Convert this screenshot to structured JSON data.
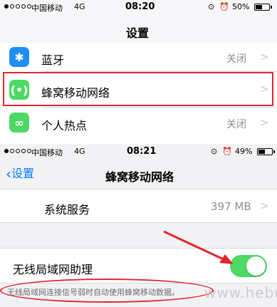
{
  "screen1": {
    "status": {
      "carrier": "中国移动",
      "network": "4G",
      "time": "08:20",
      "battery": "50%",
      "battery_level": 0.5
    },
    "title": "设置",
    "rows": [
      {
        "label": "蓝牙",
        "value": "关闭",
        "icon": "bluetooth-icon",
        "color": "#1f8ef1"
      },
      {
        "label": "蜂窝移动网络",
        "value": "",
        "icon": "cellular-icon",
        "color": "#4cd964"
      },
      {
        "label": "个人热点",
        "value": "关闭",
        "icon": "hotspot-icon",
        "color": "#4cd964"
      }
    ]
  },
  "screen2": {
    "status": {
      "carrier": "中国移动",
      "network": "4G",
      "time": "08:21",
      "battery": "49%",
      "battery_level": 0.49
    },
    "back_label": "设置",
    "title": "蜂窝移动网络",
    "system_services": {
      "label": "系统服务",
      "value": "397 MB"
    },
    "wifi_assist": {
      "label": "无线局域网助理",
      "on": true
    },
    "footer": "无线局域网连接信号弱时自动使用蜂窝移动数据。",
    "watermark": "www.hebug.cc"
  },
  "colors": {
    "accent": "#007aff",
    "highlight": "#e0262f",
    "toggle_on": "#4cd964"
  }
}
